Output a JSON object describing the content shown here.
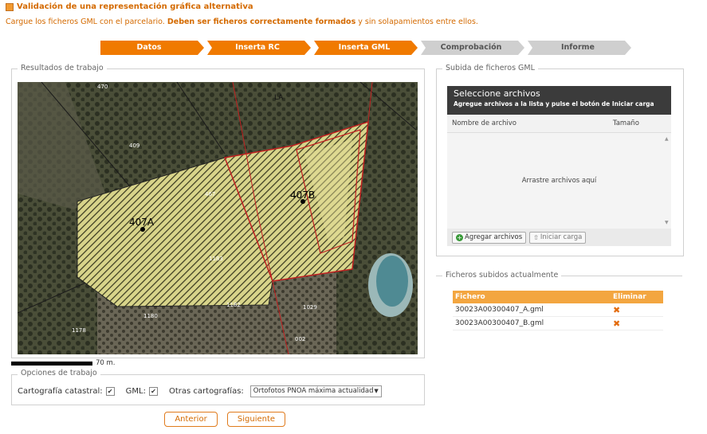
{
  "page": {
    "title": "Validación de una representación gráfica alternativa",
    "subtitle_pre": "Cargue los ficheros GML con el parcelario.",
    "subtitle_bold": "Deben ser ficheros correctamente formados",
    "subtitle_post": "y sin solapamientos entre ellos."
  },
  "steps": [
    {
      "label": "Datos",
      "state": "active"
    },
    {
      "label": "Inserta RC",
      "state": "active"
    },
    {
      "label": "Inserta GML",
      "state": "active"
    },
    {
      "label": "Comprobación",
      "state": "inactive"
    },
    {
      "label": "Informe",
      "state": "inactive"
    }
  ],
  "work": {
    "legend": "Resultados de trabajo",
    "map_labels": [
      "407A",
      "407B",
      "LA",
      "1183",
      "1182",
      "1180",
      "1178",
      "1029",
      "002",
      "467",
      "470",
      "409"
    ],
    "scale_label": "70 m."
  },
  "options": {
    "legend": "Opciones de trabajo",
    "catastral_label": "Cartografía catastral:",
    "catastral_checked": true,
    "gml_label": "GML:",
    "gml_checked": true,
    "otras_label": "Otras cartografías:",
    "otras_value": "Ortofotos PNOA máxima actualidad"
  },
  "nav": {
    "prev": "Anterior",
    "next": "Siguiente"
  },
  "upload": {
    "legend": "Subida de ficheros GML",
    "header": "Seleccione archivos",
    "header_sub": "Agregue archivos a la lista y pulse el botón de Iniciar carga",
    "col_name": "Nombre de archivo",
    "col_size": "Tamaño",
    "drop_text": "Arrastre archivos aquí",
    "add_btn": "Agregar archivos",
    "start_btn": "Iniciar carga"
  },
  "uploaded": {
    "legend": "Ficheros subidos actualmente",
    "col_file": "Fichero",
    "col_delete": "Eliminar",
    "rows": [
      {
        "file": "30023A00300407_A.gml"
      },
      {
        "file": "30023A00300407_B.gml"
      }
    ]
  },
  "colors": {
    "accent": "#f07a00",
    "step_inactive": "#cfcfcf",
    "table_head": "#f3a640"
  }
}
